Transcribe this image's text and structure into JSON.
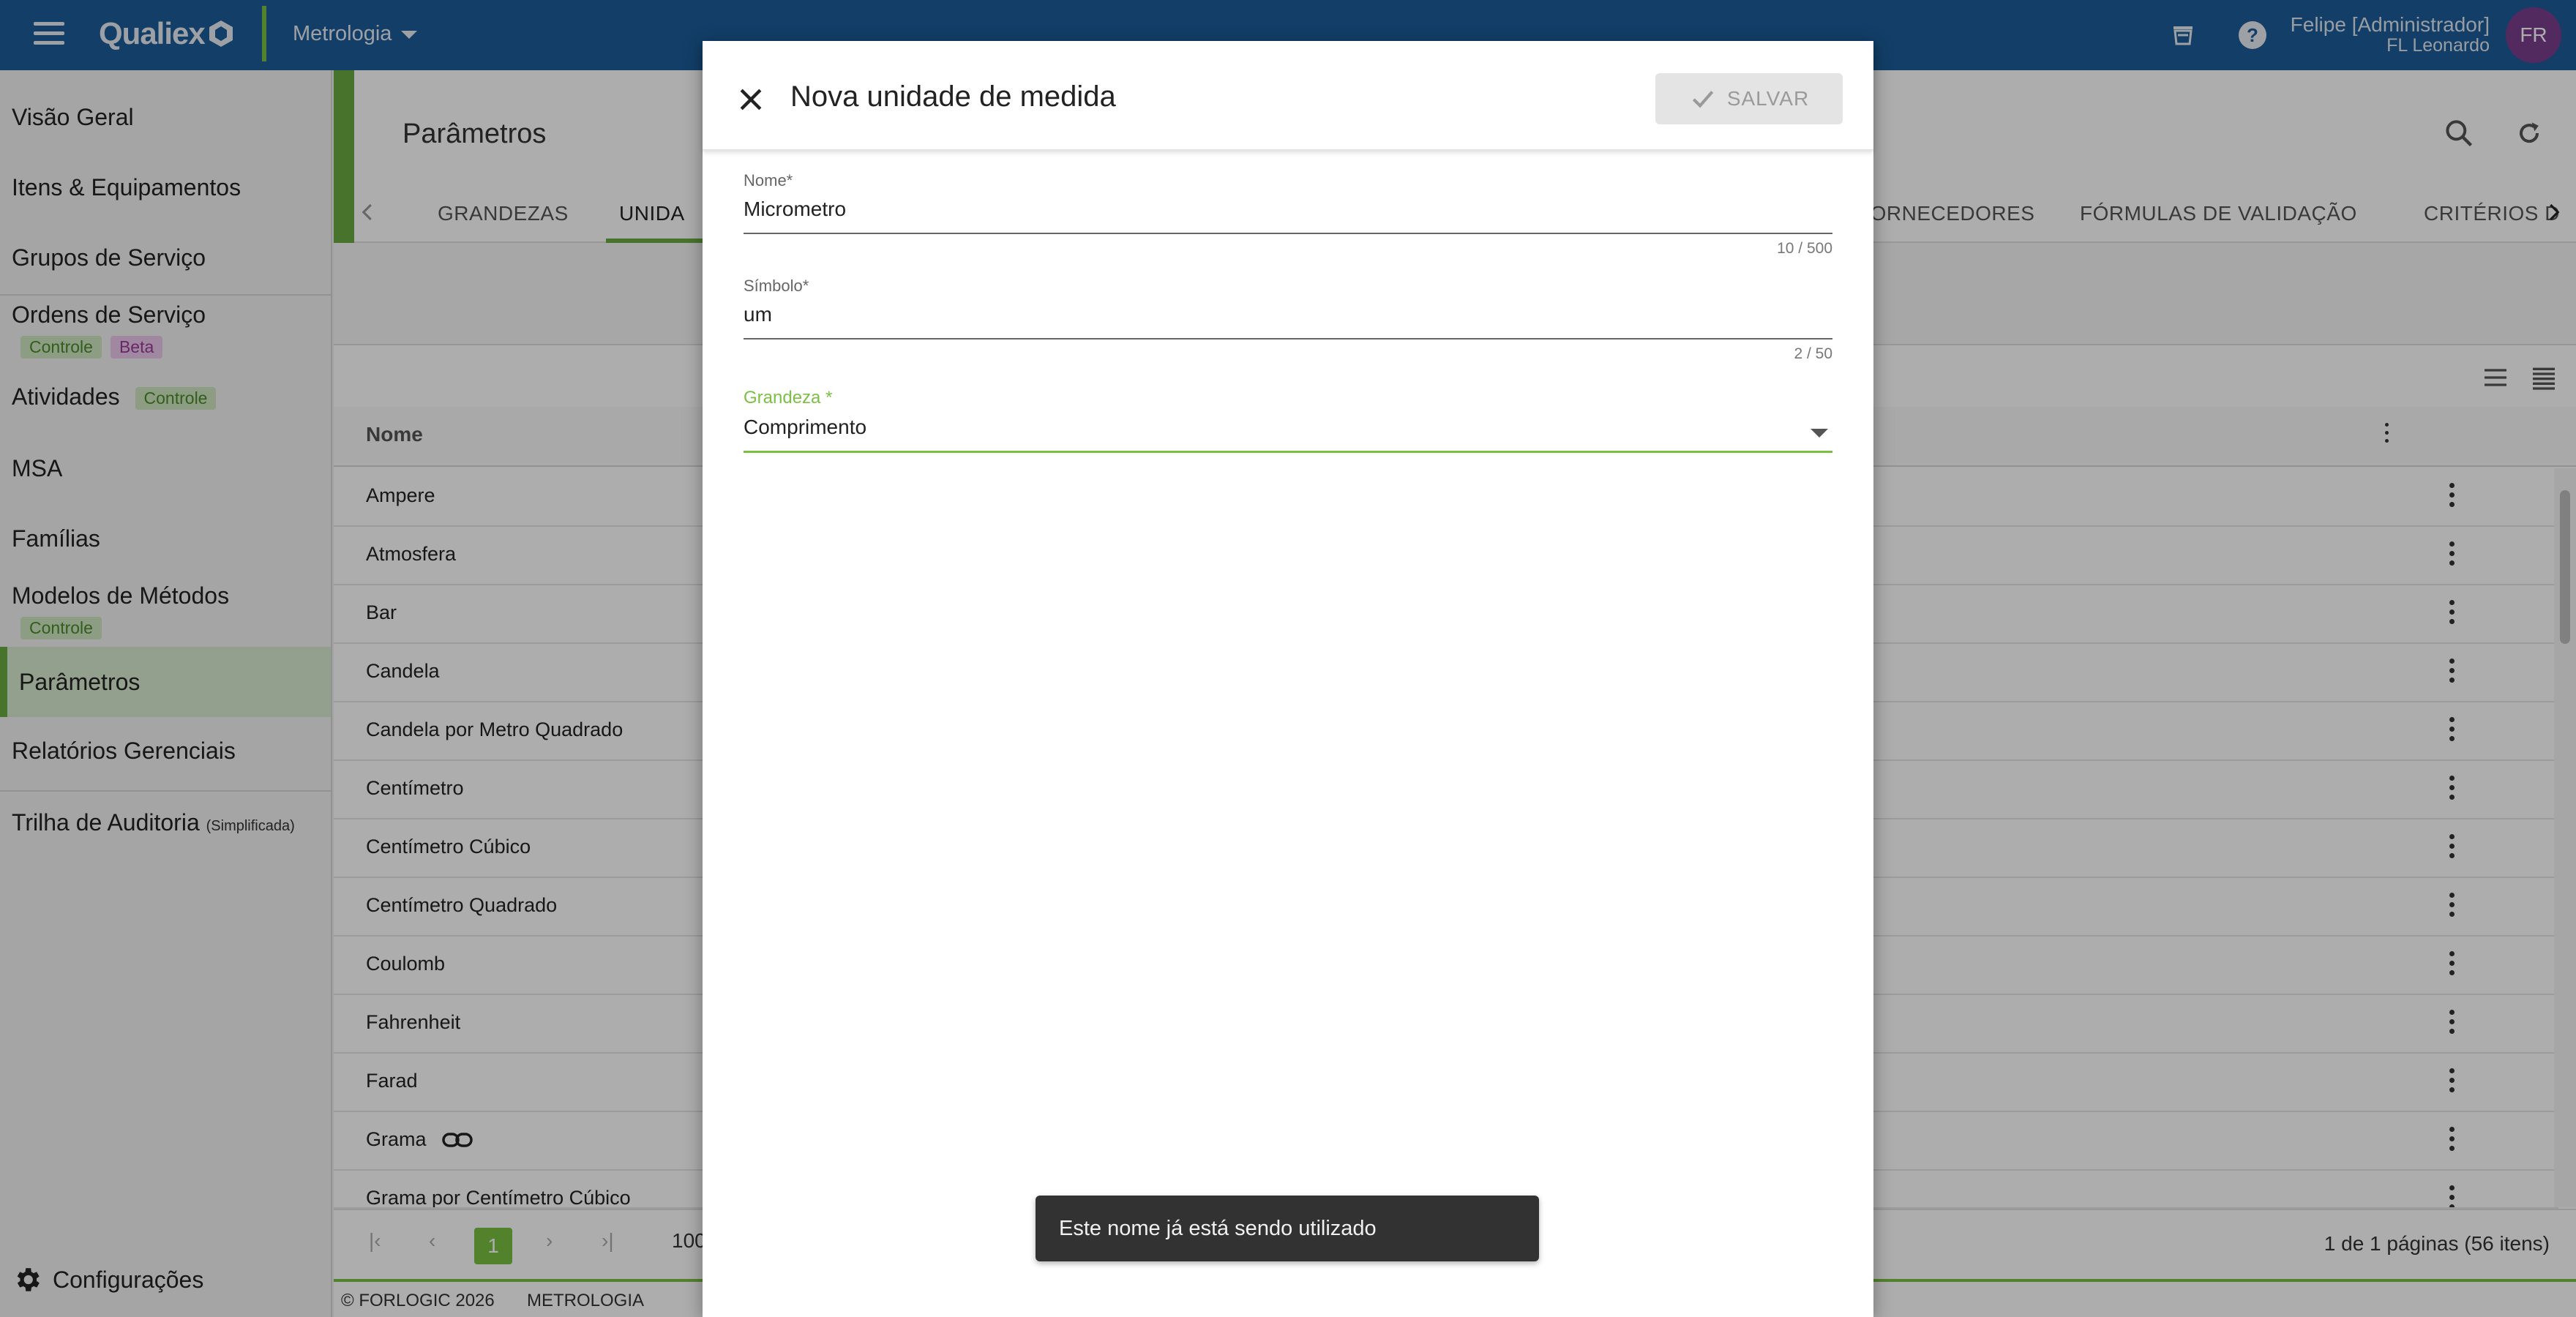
{
  "topbar": {
    "brand": "Qualiex",
    "module": "Metrologia",
    "user_name": "Felipe [Administrador]",
    "user_company": "FL Leonardo",
    "avatar_initials": "FR"
  },
  "sidebar": {
    "items": [
      {
        "label": "Visão Geral"
      },
      {
        "label": "Itens & Equipamentos"
      },
      {
        "label": "Grupos de Serviço"
      },
      {
        "label": "Ordens de Serviço",
        "badges": [
          "Controle",
          "Beta"
        ]
      },
      {
        "label": "Atividades",
        "badges": [
          "Controle"
        ]
      },
      {
        "label": "MSA"
      },
      {
        "label": "Famílias"
      },
      {
        "label": "Modelos de Métodos",
        "badges": [
          "Controle"
        ]
      },
      {
        "label": "Parâmetros"
      },
      {
        "label": "Relatórios Gerenciais"
      },
      {
        "label": "Trilha de Auditoria",
        "note": "(Simplificada)"
      }
    ],
    "settings_label": "Configurações"
  },
  "main": {
    "title": "Parâmetros",
    "tabs": [
      "GRANDEZAS",
      "UNIDA",
      "FORNECEDORES",
      "FÓRMULAS DE VALIDAÇÃO",
      "CRITÉRIOS D"
    ],
    "column_name": "Nome",
    "rows": [
      "Ampere",
      "Atmosfera",
      "Bar",
      "Candela",
      "Candela por Metro Quadrado",
      "Centímetro",
      "Centímetro Cúbico",
      "Centímetro Quadrado",
      "Coulomb",
      "Fahrenheit",
      "Farad",
      "Grama",
      "Grama por Centímetro Cúbico"
    ],
    "pager": {
      "current": "1",
      "page_size": "100",
      "info": "1 de 1 páginas (56 itens)"
    },
    "footer": {
      "copyright": "© FORLOGIC 2026",
      "module": "METROLOGIA"
    }
  },
  "dialog": {
    "title": "Nova unidade de medida",
    "save_label": "SALVAR",
    "fields": {
      "nome": {
        "label": "Nome*",
        "value": "Micrometro",
        "counter": "10 / 500"
      },
      "simbolo": {
        "label": "Símbolo*",
        "value": "um",
        "counter": "2 / 50"
      },
      "grandeza": {
        "label": "Grandeza *",
        "value": "Comprimento"
      }
    }
  },
  "snackbar": {
    "message": "Este nome já está sendo utilizado"
  },
  "colors": {
    "topbar": "#1b5c99",
    "accent": "#7bc043",
    "avatar": "#7b3f8d"
  }
}
